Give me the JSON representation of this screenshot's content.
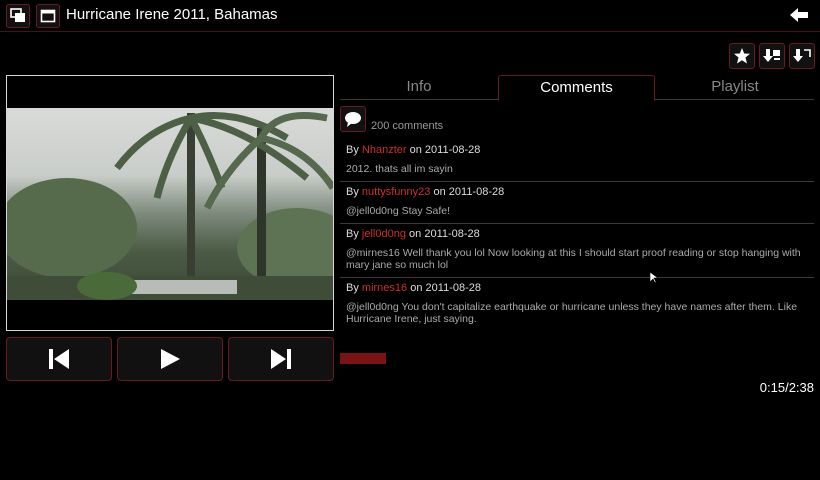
{
  "header": {
    "title": "Hurricane Irene 2011, Bahamas",
    "icons": [
      "windows-icon",
      "window-icon",
      "back-arrow-icon"
    ]
  },
  "actions": [
    "star-icon",
    "download-add-icon",
    "download-icon"
  ],
  "tabs": [
    {
      "label": "Info",
      "active": false
    },
    {
      "label": "Comments",
      "active": true
    },
    {
      "label": "Playlist",
      "active": false
    }
  ],
  "comment_count": "200 comments",
  "comments": [
    {
      "by": "By",
      "user": "Nhanzter",
      "on": "on",
      "date": "2011-08-28",
      "text": "2012. thats all im sayin"
    },
    {
      "by": "By",
      "user": "nuttysfunny23",
      "on": "on",
      "date": "2011-08-28",
      "text": "@jell0d0ng Stay Safe!"
    },
    {
      "by": "By",
      "user": "jell0d0ng",
      "on": "on",
      "date": "2011-08-28",
      "text": "@mirnes16 Well thank you lol Now looking at this I should start proof reading or stop hanging with mary jane so much lol"
    },
    {
      "by": "By",
      "user": "mirnes16",
      "on": "on",
      "date": "2011-08-28",
      "text": "@jell0d0ng You don't capitalize earthquake or hurricane unless they have names after them. Like Hurricane Irene, just saying."
    }
  ],
  "player": {
    "buttons": [
      "previous-icon",
      "play-icon",
      "next-icon"
    ],
    "time": "0:15/2:38",
    "progress": 0.095
  },
  "colors": {
    "accent": "#c9302c",
    "border": "#6b1a1f",
    "progress": "#7a1414"
  }
}
